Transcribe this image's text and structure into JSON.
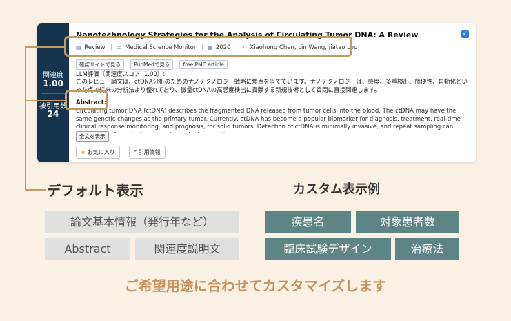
{
  "card": {
    "sidebar": {
      "relevance_label": "関連度",
      "relevance_value": "1.00",
      "citations_label": "被引用数",
      "citations_value": "24"
    },
    "title": "Nanotechnology Strategies for the Analysis of Circulating Tumor DNA: A Review",
    "checkbox_checked": true,
    "meta": {
      "type": "Review",
      "journal": "Medical Science Monitor",
      "year": "2020",
      "authors": "Xiaohong Chen, Lin Wang, Jiatao Lou"
    },
    "link_buttons": [
      "確認サイトで見る",
      "PubMedで見る",
      "free PMC article"
    ],
    "llm_heading": "LLM評価（関連度スコア: 1.00）:",
    "llm_text": "このレビュー論文は、ctDNA分析のためのナノテクノロジー戦略に焦点を当てています。ナノテクノロジーは、感度、多重検出、簡便性、自動化といった点で従来の分析法より優れており、微量ctDNAの高感度検出に貢献する新規技術として質問に直接関連します。",
    "abstract_label": "Abstract:",
    "abstract_text": "Circulating tumor DNA (ctDNA) describes the fragmented DNA released from tumor cells into the blood. The ctDNA may have the same genetic changes as the primary tumor. Currently, ctDNA has become a popular biomarker for diagnosis, treatment, real-time clinical response monitoring, and prognosis, for solid tumors. Detection of ctDNA is minimally invasive, and repeat sampling can easily be performed. However, due to its low quality an...",
    "show_all": "全文を表示",
    "favorite": "お気に入り",
    "citation_info": "引用情報"
  },
  "default_section": {
    "heading": "デフォルト表示",
    "tags": [
      "論文基本情報（発行年など）",
      "Abstract",
      "関連度説明文"
    ]
  },
  "custom_section": {
    "heading": "カスタム表示例",
    "tags": [
      "疾患名",
      "対象患者数",
      "臨床試験デザイン",
      "治療法"
    ]
  },
  "footer": "ご希望用途に合わせてカスタマイズします",
  "colors": {
    "accent": "#c39a60",
    "sidebar": "#15344f",
    "custom_tag": "#5e8585",
    "default_tag": "#e0e0e0"
  }
}
